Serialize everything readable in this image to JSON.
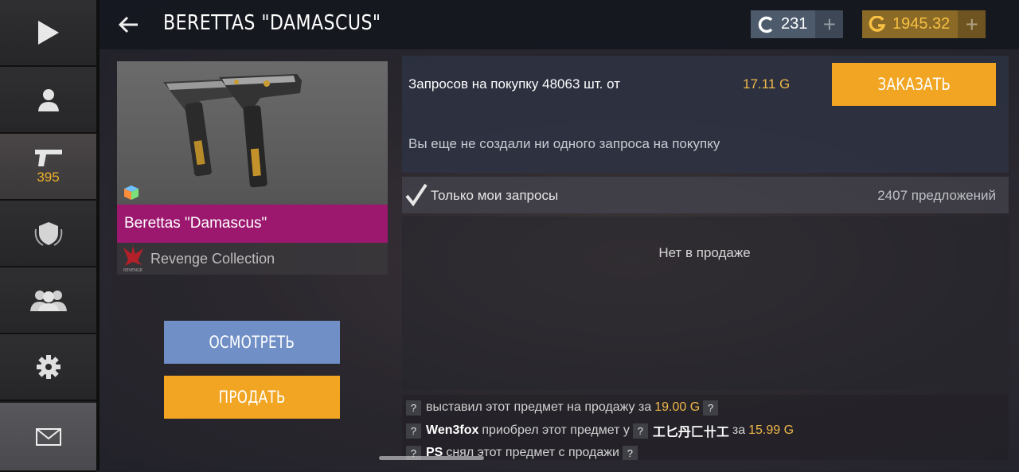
{
  "sidebar": {
    "items": [
      {
        "name": "play-icon"
      },
      {
        "name": "profile-icon"
      },
      {
        "name": "pistol-icon",
        "count": "395"
      },
      {
        "name": "shield-emblem-icon"
      },
      {
        "name": "friends-icon"
      },
      {
        "name": "gear-icon"
      },
      {
        "name": "mail-icon"
      }
    ]
  },
  "header": {
    "title": "BERETTAS \"DAMASCUS\"",
    "credits": "231",
    "gold": "1945.32",
    "plus": "+"
  },
  "item": {
    "name": "Berettas \"Damascus\"",
    "collection": "Revenge Collection",
    "collection_logo_text": "REVENGE"
  },
  "actions": {
    "inspect": "ОСМОТРЕТЬ",
    "sell": "ПРОДАТЬ"
  },
  "requests": {
    "summary": "Запросов на покупку 48063 шт. от",
    "price": "17.11 G",
    "order_button": "ЗАКАЗАТЬ",
    "none_created": "Вы еще не создали ни одного запроса на покупку"
  },
  "filter": {
    "only_mine": "Только мои запросы",
    "offers": "2407 предложений"
  },
  "listing": {
    "empty": "Нет в продаже"
  },
  "log": [
    {
      "q1": "?",
      "text1": "выставил этот предмет на продажу за",
      "price": "19.00 G",
      "q2": "?"
    },
    {
      "q1": "?",
      "user": "Wen3fox",
      "text1": "приобрел этот предмет у",
      "q2": "?",
      "seller": "工匕丹匚卄工",
      "text2": "за",
      "price": "15.99 G"
    },
    {
      "q1": "?",
      "user": "PS",
      "text1": "снял этот предмет с продажи",
      "q2": "?"
    }
  ],
  "colors": {
    "accent_orange": "#f1a522",
    "accent_blue": "#6f8fc6",
    "rarity_magenta": "#9c186f",
    "gold_text": "#f0b84a"
  }
}
